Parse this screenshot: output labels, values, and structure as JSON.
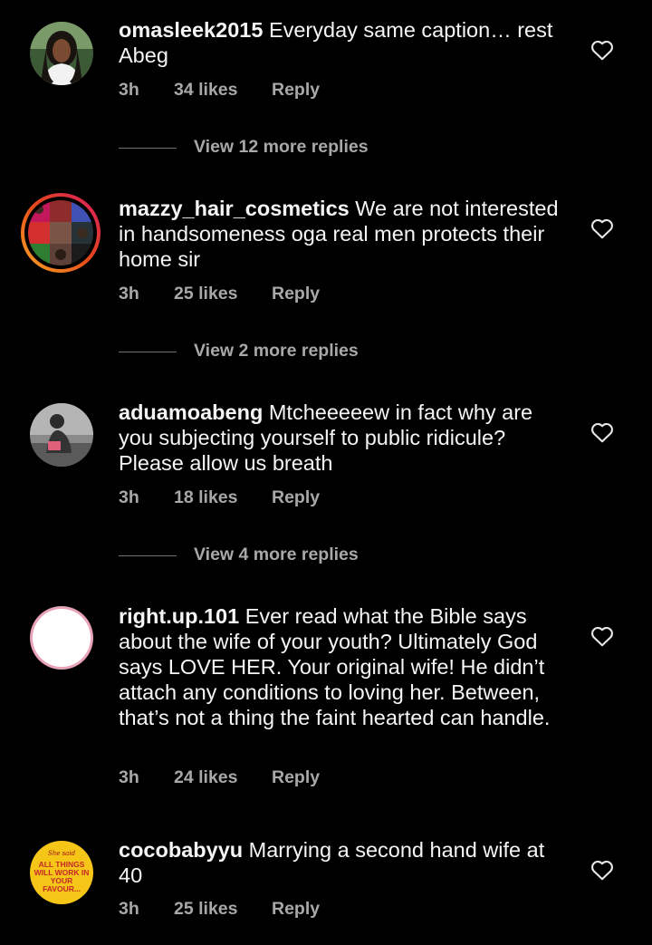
{
  "comments": [
    {
      "username": "omasleek2015",
      "text": "Everyday same caption… rest Abeg",
      "time": "3h",
      "likes": "34 likes",
      "reply": "Reply",
      "view_replies": "View 12 more replies",
      "avatar": "woman-portrait-avatar"
    },
    {
      "username": "mazzy_hair_cosmetics",
      "text": "We are not interested in handsomeness oga real men protects their home sir",
      "time": "3h",
      "likes": "25 likes",
      "reply": "Reply",
      "view_replies": "View 2 more replies",
      "avatar": "collage-avatar-story-ring"
    },
    {
      "username": "aduamoabeng",
      "text": "Mtcheeeeew in fact why are you subjecting yourself to public ridicule? Please allow us breath",
      "time": "3h",
      "likes": "18 likes",
      "reply": "Reply",
      "view_replies": "View 4 more replies",
      "avatar": "person-outdoor-avatar"
    },
    {
      "username": "right.up.101",
      "text": "Ever read what the Bible says about the wife of your youth? Ultimately God says LOVE HER. Your original wife! He didn’t attach any conditions to loving  her. Between, that’s  not a thing the faint hearted  can handle.",
      "time": "3h",
      "likes": "24 likes",
      "reply": "Reply",
      "avatar": "blank-white-avatar"
    },
    {
      "username": "cocobabyyu",
      "text": "Marrying a second hand wife at 40",
      "time": "3h",
      "likes": "25 likes",
      "reply": "Reply",
      "avatar": "yellow-quote-avatar",
      "avatar_text_small": "She said",
      "avatar_text": "ALL THINGS WILL WORK IN YOUR FAVOUR..."
    }
  ],
  "colors": {
    "background": "#000000",
    "text": "#f5f5f5",
    "meta": "#a8a8a8",
    "story_ring_start": "#f9a825",
    "story_ring_end": "#d81b60",
    "yellow_avatar": "#f5c518"
  },
  "icons": {
    "like": "heart-outline-icon"
  }
}
